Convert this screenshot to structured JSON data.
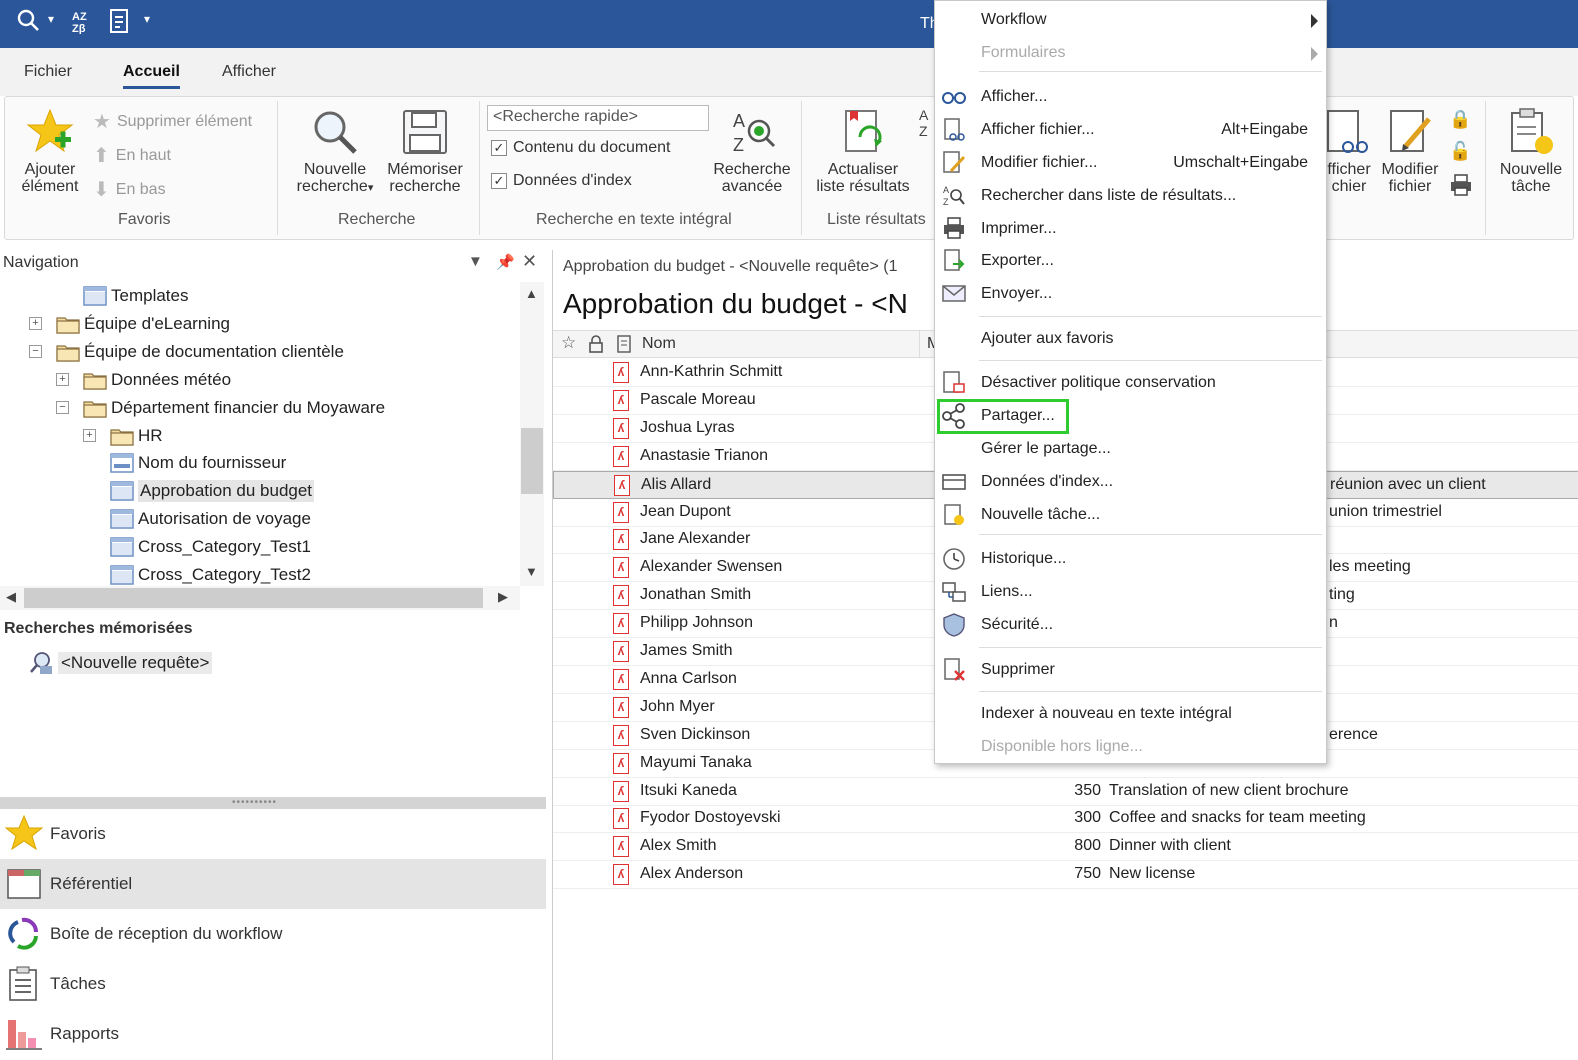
{
  "titlebar": {
    "title": "Th",
    "quick_access": [
      "search-icon",
      "dropdown-icon",
      "sort-az-icon",
      "document-icon",
      "customize-icon"
    ]
  },
  "tabs": [
    {
      "label": "Fichier"
    },
    {
      "label": "Accueil",
      "active": true
    },
    {
      "label": "Afficher"
    }
  ],
  "ribbon": {
    "favoris": {
      "add_label_1": "Ajouter",
      "add_label_2": "élément",
      "remove_label": "Supprimer élément",
      "up_label": "En haut",
      "down_label": "En bas",
      "group_label": "Favoris"
    },
    "recherche": {
      "new_label_1": "Nouvelle",
      "new_label_2": "recherche",
      "save_label_1": "Mémoriser",
      "save_label_2": "recherche",
      "group_label": "Recherche"
    },
    "fulltext": {
      "quick_search_placeholder": "<Recherche rapide>",
      "check_content": "Contenu du document",
      "check_index": "Données d'index",
      "advanced_label_1": "Recherche",
      "advanced_label_2": "avancée",
      "group_label": "Recherche en texte intégral"
    },
    "results": {
      "refresh_label_1": "Actualiser",
      "refresh_label_2": "liste résultats",
      "group_label": "Liste résultats"
    },
    "right": {
      "view_file_1": "fficher",
      "view_file_2": "chier",
      "edit_file_1": "Modifier",
      "edit_file_2": "fichier",
      "new_task_1": "Nouvelle",
      "new_task_2": "tâche"
    }
  },
  "navigation": {
    "title": "Navigation",
    "tree": [
      {
        "label": "Templates",
        "level": 3,
        "expander": ""
      },
      {
        "label": "Équipe d'eLearning",
        "level": 2,
        "expander": "+"
      },
      {
        "label": "Équipe de documentation clientèle",
        "level": 2,
        "expander": "−"
      },
      {
        "label": "Données météo",
        "level": 3,
        "expander": "+"
      },
      {
        "label": "Département financier du Moyaware",
        "level": 3,
        "expander": "−"
      },
      {
        "label": "HR",
        "level": 4,
        "expander": "+"
      },
      {
        "label": "Nom du fournisseur",
        "level": 4,
        "expander": ""
      },
      {
        "label": "Approbation du budget",
        "level": 4,
        "expander": "",
        "selected": true
      },
      {
        "label": "Autorisation de voyage",
        "level": 4,
        "expander": ""
      },
      {
        "label": "Cross_Category_Test1",
        "level": 4,
        "expander": ""
      },
      {
        "label": "Cross_Category_Test2",
        "level": 4,
        "expander": ""
      }
    ],
    "saved_searches_title": "Recherches mémorisées",
    "saved_query": "<Nouvelle requête>",
    "panes": [
      {
        "label": "Favoris",
        "icon": "star-icon"
      },
      {
        "label": "Référentiel",
        "icon": "repository-icon",
        "selected": true
      },
      {
        "label": "Boîte de réception du workflow",
        "icon": "workflow-icon"
      },
      {
        "label": "Tâches",
        "icon": "tasks-icon"
      },
      {
        "label": "Rapports",
        "icon": "reports-icon"
      }
    ]
  },
  "results": {
    "tab_label": "Approbation du budget - <Nouvelle requête> (1",
    "heading": "Approbation du budget - <N",
    "columns": {
      "name": "Nom",
      "m": "M"
    },
    "rows": [
      {
        "name": "Ann-Kathrin Schmitt",
        "amount": "",
        "desc": "",
        "trail": ""
      },
      {
        "name": "Pascale Moreau",
        "amount": "",
        "desc": "",
        "trail": ""
      },
      {
        "name": "Joshua Lyras",
        "amount": "",
        "desc": "",
        "trail": ""
      },
      {
        "name": "Anastasie Trianon",
        "amount": "",
        "desc": "",
        "trail": ""
      },
      {
        "name": "Alis Allard",
        "amount": "",
        "desc": "",
        "trail": "réunion avec un client",
        "selected": true
      },
      {
        "name": "Jean Dupont",
        "amount": "",
        "desc": "",
        "trail": "union trimestriel"
      },
      {
        "name": "Jane Alexander",
        "amount": "",
        "desc": "",
        "trail": ""
      },
      {
        "name": "Alexander Swensen",
        "amount": "",
        "desc": "",
        "trail": "les meeting"
      },
      {
        "name": "Jonathan Smith",
        "amount": "",
        "desc": "",
        "trail": "ting"
      },
      {
        "name": "Philipp Johnson",
        "amount": "",
        "desc": "",
        "trail": "n"
      },
      {
        "name": "James Smith",
        "amount": "",
        "desc": "",
        "trail": ""
      },
      {
        "name": "Anna Carlson",
        "amount": "",
        "desc": "",
        "trail": ""
      },
      {
        "name": "John Myer",
        "amount": "",
        "desc": "",
        "trail": ""
      },
      {
        "name": "Sven Dickinson",
        "amount": "",
        "desc": "",
        "trail": "erence"
      },
      {
        "name": "Mayumi Tanaka",
        "amount": "",
        "desc": "",
        "trail": ""
      },
      {
        "name": "Itsuki Kaneda",
        "amount": "350",
        "desc": "Translation of new client brochure",
        "trail": ""
      },
      {
        "name": "Fyodor Dostoyevski",
        "amount": "300",
        "desc": "Coffee and snacks for team meeting",
        "trail": ""
      },
      {
        "name": "Alex Smith",
        "amount": "800",
        "desc": "Dinner with client",
        "trail": ""
      },
      {
        "name": "Alex Anderson",
        "amount": "750",
        "desc": "New license",
        "trail": ""
      }
    ]
  },
  "context_menu": {
    "items": [
      {
        "label": "Workflow",
        "submenu": true
      },
      {
        "label": "Formulaires",
        "submenu": true,
        "disabled": true
      },
      {
        "label": "Afficher...",
        "icon": "glasses-icon"
      },
      {
        "label": "Afficher fichier...",
        "shortcut": "Alt+Eingabe",
        "icon": "view-file-icon"
      },
      {
        "label": "Modifier fichier...",
        "shortcut": "Umschalt+Eingabe",
        "icon": "edit-file-icon"
      },
      {
        "label": "Rechercher dans liste de résultats...",
        "icon": "search-results-icon"
      },
      {
        "label": "Imprimer...",
        "icon": "printer-icon"
      },
      {
        "label": "Exporter...",
        "icon": "export-icon"
      },
      {
        "label": "Envoyer...",
        "icon": "envelope-icon"
      },
      {
        "label": "Ajouter aux favoris"
      },
      {
        "label": "Désactiver politique conservation",
        "icon": "retention-icon"
      },
      {
        "label": "Partager...",
        "icon": "share-icon",
        "highlighted": true
      },
      {
        "label": "Gérer le partage..."
      },
      {
        "label": "Données d'index...",
        "icon": "index-data-icon"
      },
      {
        "label": "Nouvelle tâche...",
        "icon": "new-task-icon"
      },
      {
        "label": "Historique...",
        "icon": "history-icon"
      },
      {
        "label": "Liens...",
        "icon": "links-icon"
      },
      {
        "label": "Sécurité...",
        "icon": "security-icon"
      },
      {
        "label": "Supprimer",
        "icon": "delete-icon"
      },
      {
        "label": "Indexer à nouveau en texte intégral"
      },
      {
        "label": "Disponible hors ligne...",
        "disabled": true
      }
    ],
    "highlight_color": "#2ecc2e"
  },
  "colors": {
    "titlebar": "#2b579a",
    "pdf": "#d33333"
  }
}
